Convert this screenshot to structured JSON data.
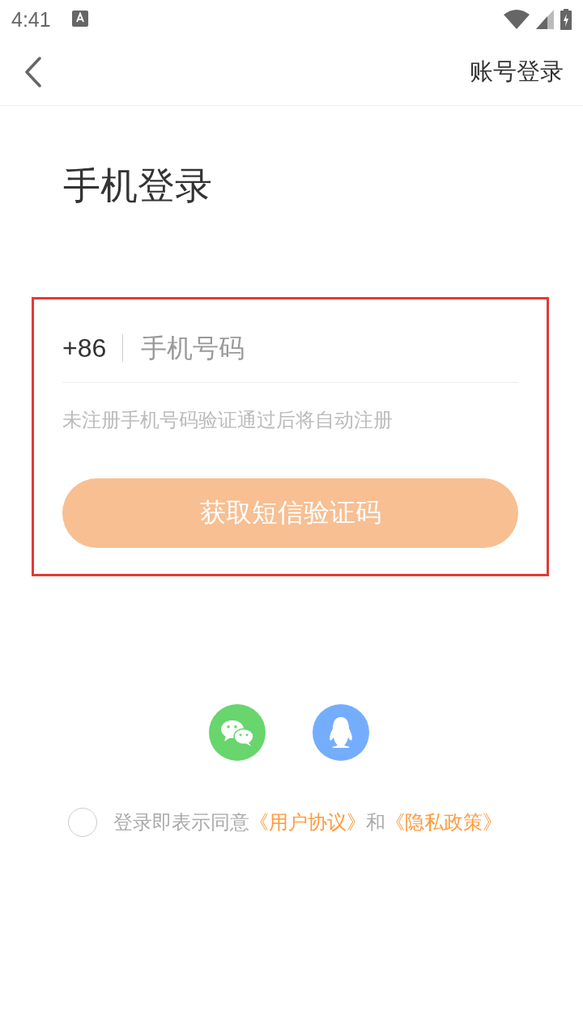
{
  "status_bar": {
    "time": "4:41"
  },
  "header": {
    "action": "账号登录"
  },
  "title": "手机登录",
  "form": {
    "highlighted": true,
    "country_code": "+86",
    "phone_placeholder": "手机号码",
    "hint": "未注册手机号码验证通过后将自动注册",
    "submit": {
      "label": "获取短信验证码",
      "disabled": true
    }
  },
  "social_logins": [
    {
      "kind": "wechat",
      "color": "#68d56d"
    },
    {
      "kind": "qq",
      "color": "#75adfd"
    }
  ],
  "agreement": {
    "checked": false,
    "parts": [
      {
        "kind": "text",
        "text": "登录即表示同意"
      },
      {
        "kind": "link",
        "text": "《用户协议》"
      },
      {
        "kind": "text",
        "text": "和"
      },
      {
        "kind": "link",
        "text": "《隐私政策》"
      }
    ]
  }
}
